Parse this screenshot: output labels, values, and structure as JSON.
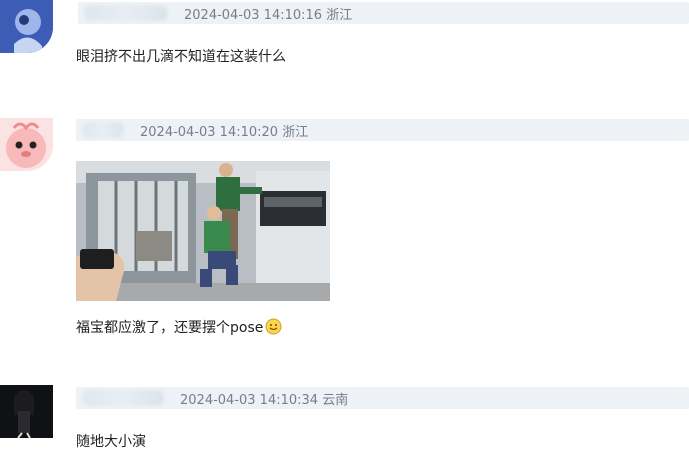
{
  "comments": [
    {
      "username": "",
      "timestamp": "2024-04-03 14:10:16",
      "location": "浙江",
      "text": "眼泪挤不出几滴不知道在这装什么"
    },
    {
      "username": "",
      "timestamp": "2024-04-03 14:10:20",
      "location": "浙江",
      "text": "福宝都应激了，还要摆个pose",
      "emoji": "smile-emoji"
    },
    {
      "username": "",
      "timestamp": "2024-04-03 14:10:34",
      "location": "云南",
      "text": "随地大小演"
    }
  ],
  "colors": {
    "meta_bar": "#eef2f6",
    "meta_text": "#777e86",
    "body_text": "#222222"
  }
}
